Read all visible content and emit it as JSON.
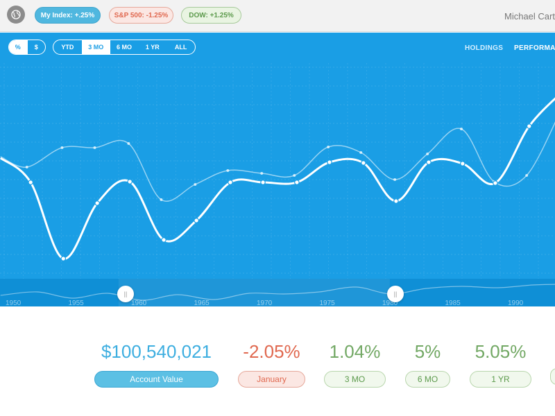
{
  "topbar": {
    "globe_icon": "globe-icon",
    "indices": [
      {
        "label": "My Index: +.25%"
      },
      {
        "label": "S&P 500: -1.25%"
      },
      {
        "label": "DOW: +1.25%"
      }
    ],
    "user_name": "Michael Carte"
  },
  "toolbar": {
    "unit_options": [
      "%",
      "$"
    ],
    "unit_selected": "%",
    "range_options": [
      "YTD",
      "3 MO",
      "6 MO",
      "1 YR",
      "ALL"
    ],
    "range_selected": "3 MO",
    "nav": {
      "holdings": "HOLDINGS",
      "performance": "PERFORMA"
    }
  },
  "chart_data": {
    "type": "line",
    "x_ticks": [
      "1950",
      "1955",
      "1960",
      "1965",
      "1970",
      "1975",
      "1980",
      "1985",
      "1990"
    ],
    "main_series": [
      {
        "x": 1949.6,
        "y": 228
      },
      {
        "x": 1952,
        "y": 263
      },
      {
        "x": 1954.6,
        "y": 373
      },
      {
        "x": 1957.3,
        "y": 293
      },
      {
        "x": 1959.9,
        "y": 262
      },
      {
        "x": 1962.6,
        "y": 346
      },
      {
        "x": 1965.2,
        "y": 318
      },
      {
        "x": 1967.9,
        "y": 263
      },
      {
        "x": 1970.5,
        "y": 263
      },
      {
        "x": 1973.2,
        "y": 263
      },
      {
        "x": 1975.8,
        "y": 234
      },
      {
        "x": 1978.5,
        "y": 235
      },
      {
        "x": 1981.1,
        "y": 290
      },
      {
        "x": 1983.7,
        "y": 234
      },
      {
        "x": 1986.4,
        "y": 236
      },
      {
        "x": 1989.0,
        "y": 264
      },
      {
        "x": 1991.7,
        "y": 182
      },
      {
        "x": 1994.3,
        "y": 133
      }
    ],
    "secondary_series": [
      {
        "x": 1949.6,
        "y": 226
      },
      {
        "x": 1951.7,
        "y": 241
      },
      {
        "x": 1954.5,
        "y": 213
      },
      {
        "x": 1957.1,
        "y": 213
      },
      {
        "x": 1959.8,
        "y": 207
      },
      {
        "x": 1962.4,
        "y": 288
      },
      {
        "x": 1965.1,
        "y": 266
      },
      {
        "x": 1967.7,
        "y": 246
      },
      {
        "x": 1970.4,
        "y": 250
      },
      {
        "x": 1973.0,
        "y": 253
      },
      {
        "x": 1975.7,
        "y": 212
      },
      {
        "x": 1978.3,
        "y": 220
      },
      {
        "x": 1981.0,
        "y": 259
      },
      {
        "x": 1983.6,
        "y": 222
      },
      {
        "x": 1986.3,
        "y": 186
      },
      {
        "x": 1988.9,
        "y": 262
      },
      {
        "x": 1991.5,
        "y": 253
      },
      {
        "x": 1994.2,
        "y": 160
      }
    ],
    "navigator_series": [
      {
        "x": 1949.6,
        "y": 426
      },
      {
        "x": 1952.5,
        "y": 421
      },
      {
        "x": 1955.3,
        "y": 430
      },
      {
        "x": 1958.1,
        "y": 423
      },
      {
        "x": 1960.9,
        "y": 433
      },
      {
        "x": 1963.7,
        "y": 425
      },
      {
        "x": 1966.6,
        "y": 432
      },
      {
        "x": 1969.4,
        "y": 423
      },
      {
        "x": 1972.2,
        "y": 424
      },
      {
        "x": 1975.0,
        "y": 421
      },
      {
        "x": 1977.9,
        "y": 414
      },
      {
        "x": 1980.7,
        "y": 424
      },
      {
        "x": 1983.5,
        "y": 416
      },
      {
        "x": 1986.3,
        "y": 413
      },
      {
        "x": 1989.2,
        "y": 415
      },
      {
        "x": 1992.0,
        "y": 411
      },
      {
        "x": 1994.3,
        "y": 410
      }
    ],
    "selection_range": [
      1959.0,
      1980.6
    ],
    "grid": true
  },
  "stats": [
    {
      "value": "$100,540,021",
      "label": "Account Value"
    },
    {
      "value": "-2.05%",
      "label": "January"
    },
    {
      "value": "1.04%",
      "label": "3 MO"
    },
    {
      "value": "5%",
      "label": "6 MO"
    },
    {
      "value": "5.05%",
      "label": "1 YR"
    }
  ],
  "colors": {
    "chart_bg": "#1a9ee5",
    "primary": "#3daee0",
    "negative": "#e0684f",
    "positive": "#72a864"
  }
}
